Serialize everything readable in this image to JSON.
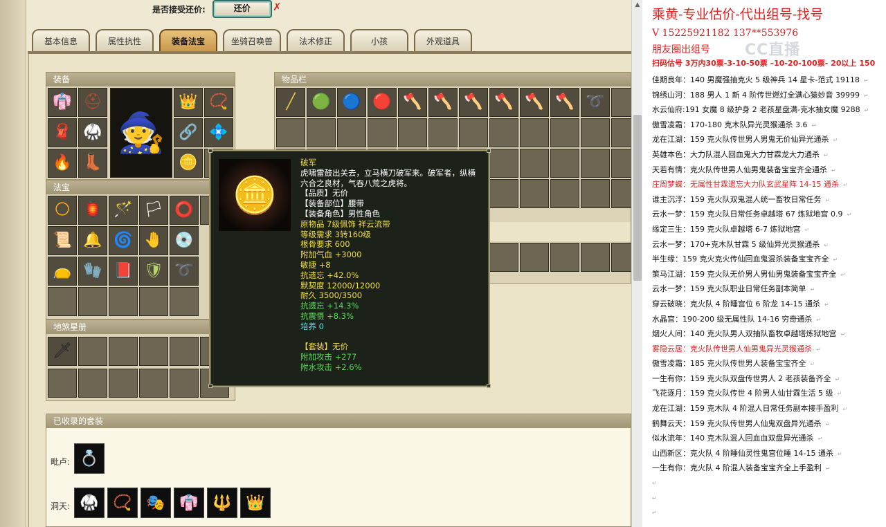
{
  "game": {
    "accept_label": "是否接受还价:",
    "counter_button": "还价",
    "tabs": [
      "基本信息",
      "属性抗性",
      "装备法宝",
      "坐骑召唤兽",
      "法术修正",
      "小孩",
      "外观道具"
    ],
    "active_tab": 2,
    "panels": {
      "equipment": "装备",
      "treasure": "法宝",
      "star_book": "地煞星册",
      "inventory": "物品栏",
      "collected_sets": "已收录的套装"
    },
    "equip_left": [
      {
        "icon": "robe-icon",
        "glyph": "👘",
        "color": "#c02a2a"
      },
      {
        "icon": "helmet-icon",
        "glyph": "⛑",
        "color": "#b84a3a"
      },
      {
        "icon": "scarf-icon",
        "glyph": "🧣",
        "color": "#c03030"
      },
      {
        "icon": "armor-icon",
        "glyph": "🥋",
        "color": "#e8e0b0"
      },
      {
        "icon": "flame-icon",
        "glyph": "🔥",
        "color": "#5a7bff"
      },
      {
        "icon": "boots-icon",
        "glyph": "👢",
        "color": "#e0b84a"
      }
    ],
    "equip_right": [
      {
        "icon": "crown-icon",
        "glyph": "👑",
        "color": "#e8c64a"
      },
      {
        "icon": "necklace-icon",
        "glyph": "📿",
        "color": "#ddd"
      },
      {
        "icon": "belt-icon",
        "glyph": "🔗",
        "color": "#d0c0a0"
      },
      {
        "icon": "crystal-icon",
        "glyph": "💠",
        "color": "#3ad9a5"
      },
      {
        "icon": "belt-icon",
        "glyph": "🪙",
        "color": "#e6b552"
      }
    ],
    "character_icon": "character-figure-icon",
    "character_glyph": "🧙",
    "treasures": [
      {
        "icon": "orb-icon",
        "glyph": "🌕",
        "color": "#ffb020"
      },
      {
        "icon": "lantern-icon",
        "glyph": "🏮",
        "color": "#ff6bd3"
      },
      {
        "icon": "staff-icon",
        "glyph": "🪄",
        "color": "#b388ff"
      },
      {
        "icon": "flag-icon",
        "glyph": "🏳",
        "color": "#ffffff"
      },
      {
        "icon": "ring-icon",
        "glyph": "⭕",
        "color": "#ff7a3a"
      },
      {
        "icon": "scroll-icon",
        "glyph": "📜",
        "color": "#c9a46a"
      },
      {
        "icon": "bell-icon",
        "glyph": "🔔",
        "color": "#ffd34a"
      },
      {
        "icon": "vortex-icon",
        "glyph": "🌀",
        "color": "#9a5cff"
      },
      {
        "icon": "claw-icon",
        "glyph": "🤚",
        "color": "#8fb3ff"
      },
      {
        "icon": "disc-icon",
        "glyph": "💿",
        "color": "#e0e0e0"
      },
      {
        "icon": "pouch-icon",
        "glyph": "👝",
        "color": "#b07ae8"
      },
      {
        "icon": "gauntlet-icon",
        "glyph": "🧤",
        "color": "#9ac8ff"
      },
      {
        "icon": "book-icon",
        "glyph": "📕",
        "color": "#ff8c3a"
      },
      {
        "icon": "shield-icon",
        "glyph": "🛡",
        "color": "#b4d46a"
      },
      {
        "icon": "whip-icon",
        "glyph": "➰",
        "color": "#c06aff"
      }
    ],
    "star_item": {
      "icon": "warrior-card-icon",
      "glyph": "🗡"
    },
    "inventory": [
      {
        "icon": "spear-icon",
        "glyph": "╱",
        "color": "#e8c24a"
      },
      {
        "icon": "green-orb-icon",
        "glyph": "🟢",
        "color": "#4ad98a"
      },
      {
        "icon": "blue-orb-icon",
        "glyph": "🔵",
        "color": "#3aa0e8"
      },
      {
        "icon": "red-orb-icon",
        "glyph": "🔴",
        "color": "#e04a3a"
      },
      {
        "icon": "axe-icon",
        "glyph": "🪓",
        "color": "#cfcfcf"
      },
      {
        "icon": "axe-icon",
        "glyph": "🪓",
        "color": "#cfcfcf"
      },
      {
        "icon": "axe-icon",
        "glyph": "🪓",
        "color": "#cfcfcf"
      },
      {
        "icon": "axe-icon",
        "glyph": "🪓",
        "color": "#cfcfcf"
      },
      {
        "icon": "axe-icon",
        "glyph": "🪓",
        "color": "#cfcfcf"
      },
      {
        "icon": "axe-icon",
        "glyph": "🪓",
        "color": "#cfcfcf"
      },
      {
        "icon": "fire-ring-icon",
        "glyph": "➰",
        "color": "#ff8c3a"
      }
    ],
    "sets": {
      "hut_label": "毗卢:",
      "hut_item": {
        "icon": "golden-ring-icon",
        "glyph": "💍"
      },
      "cave_label": "洞天:",
      "cave_items": [
        {
          "icon": "armor-set-icon",
          "glyph": "🥋"
        },
        {
          "icon": "necklace-set-icon",
          "glyph": "📿"
        },
        {
          "icon": "mask-set-icon",
          "glyph": "🎭"
        },
        {
          "icon": "robe-set-icon",
          "glyph": "👘"
        },
        {
          "icon": "amulet-set-icon",
          "glyph": "🔱"
        },
        {
          "icon": "crown-set-icon",
          "glyph": "👑"
        }
      ]
    }
  },
  "tooltip": {
    "image_icon": "belt-item-icon",
    "image_glyph": "🪙",
    "lines": [
      {
        "text": "破军",
        "color": "c-y"
      },
      {
        "text": "虎啸雷鼓出关去，立马横刀破军来。破军者，纵横",
        "color": "c-w"
      },
      {
        "text": "六合之良材，气吞八荒之虎将。",
        "color": "c-w"
      },
      {
        "text": "【品质】无价",
        "color": "c-w"
      },
      {
        "text": "【装备部位】腰带",
        "color": "c-w"
      },
      {
        "text": "【装备角色】男性角色",
        "color": "c-w"
      },
      {
        "text": "原物品 7级佩饰 祥云流带",
        "color": "c-y"
      },
      {
        "text": "等级需求 3转160级",
        "color": "c-y"
      },
      {
        "text": "根骨要求 600",
        "color": "c-y"
      },
      {
        "text": "附加气血 +3000",
        "color": "c-y"
      },
      {
        "text": "敏捷 +8",
        "color": "c-y"
      },
      {
        "text": "抗遗忘 +42.0%",
        "color": "c-y"
      },
      {
        "text": "默契度 12000/12000",
        "color": "c-y"
      },
      {
        "text": "耐久 3500/3500",
        "color": "c-y"
      },
      {
        "text": "抗遗忘 +14.3%",
        "color": "c-g"
      },
      {
        "text": "抗震慑 +8.3%",
        "color": "c-g"
      },
      {
        "text": "培养 0",
        "color": "c-c"
      },
      {
        "text": "",
        "color": "c-w"
      },
      {
        "text": "【套装】无价",
        "color": "c-y"
      },
      {
        "text": "附加攻击 +277",
        "color": "c-g"
      },
      {
        "text": "附水攻击 +2.6%",
        "color": "c-g"
      }
    ]
  },
  "sidebar": {
    "title": "乘黄-专业估价-代出组号-找号",
    "phone": "V 15225921182   137**553976",
    "friends": "朋友圈出组号",
    "watermark": "CC直播",
    "price_line": "扫码估号 3万内30票-3-10-50票 –10-20-100票- 20以上 150",
    "accounts": [
      {
        "text": "佳期良年：140 男魔强抽克火 5 级神兵 14 星卡-范式 19118",
        "red": false
      },
      {
        "text": "锦绣山河：188 男人 1 新 4 阶传世燃灯全满心猿妙音 39999",
        "red": false
      },
      {
        "text": "水云仙府:191 女魔 8 级护身 2 老孩星盘满-克水抽女魔 9288",
        "red": false
      },
      {
        "text": "傲雪凌霜：170-180 克木队异光灵猴通杀 3.6",
        "red": false
      },
      {
        "text": "龙在江湖：159 克火队传世男人男鬼无价仙异光通杀",
        "red": false
      },
      {
        "text": "英雄本色：大力队混人回血鬼大力甘霖龙大力通杀",
        "red": false
      },
      {
        "text": "天若有情：克火队传世男人仙男鬼装备宝宝齐全通杀",
        "red": false
      },
      {
        "text": "庄周梦蝶：无属性甘霖遗忘大力队玄武星阵 14-15 通杀",
        "red": true
      },
      {
        "text": "谁主沉浮：159 克火队双鬼混人统一畜牧日常任务",
        "red": false
      },
      {
        "text": "云水一梦：159 克火队日常任务卓越塔 67 炼狱地宫 0.9",
        "red": false
      },
      {
        "text": "缘定三生：159 克火队卓越塔 6-7 炼狱地宫",
        "red": false
      },
      {
        "text": "云水一梦：170+克木队甘霖 5 级仙异光灵猴通杀",
        "red": false
      },
      {
        "text": "半生缘：159 克火克火传仙回血鬼混杀装备宝宝齐全",
        "red": false
      },
      {
        "text": "策马江湖：159 克火队无价男人男仙男鬼装备宝宝齐全",
        "red": false
      },
      {
        "text": "云水一梦：159 克火队职业日常任务副本简单",
        "red": false
      },
      {
        "text": "穿云破晓：克火队 4 阶睡宫位 6 阶龙 14-15 通杀",
        "red": false
      },
      {
        "text": "水晶宫：190-200 级无属性队 14-16 穷奇通杀",
        "red": false
      },
      {
        "text": "烟火人间：140 克火队男人双抽队畜牧卓越塔炼狱地宫",
        "red": false
      },
      {
        "text": "雾隐云居：克火队传世男人仙男鬼异光灵猴通杀",
        "red": true
      },
      {
        "text": "傲雪凌霜：185 克火队传世男人装备宝宝齐全",
        "red": false
      },
      {
        "text": "一生有你：159 克火队双盘传世男人 2 老孩装备齐全",
        "red": false
      },
      {
        "text": "飞花逐月：159 克火队传世 4 阶男人仙甘霖生活 5 级",
        "red": false
      },
      {
        "text": "龙在江湖：159 克木队 4 阶混人日常任务副本接手盈利",
        "red": false
      },
      {
        "text": "鹤舞云天：159 克火队传世男人仙鬼双盘异光通杀",
        "red": false
      },
      {
        "text": "似水流年：140 克木队混人回血血双盘异光通杀",
        "red": false
      },
      {
        "text": "山西新区：克火队 4 阶睡仙灵性鬼宫位睡 14-15 通杀",
        "red": false
      },
      {
        "text": "一生有你：克火队 4 阶混人装备宝宝齐全上手盈利",
        "red": false
      }
    ],
    "return_mark": "↵"
  }
}
